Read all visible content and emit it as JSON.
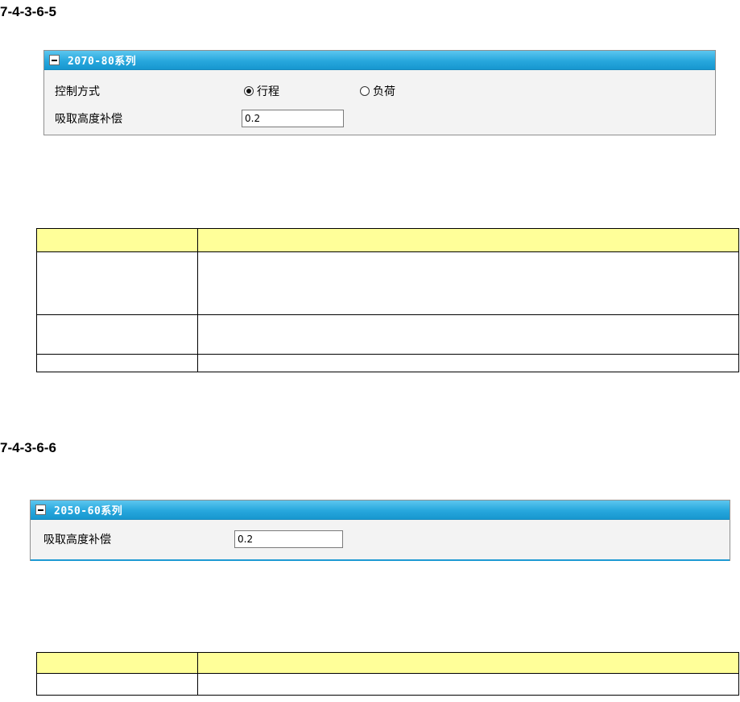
{
  "section1": {
    "number": "7-4-3-6-5",
    "panel": {
      "title": "2070-80系列",
      "control_label": "控制方式",
      "option_stroke": "行程",
      "option_load": "负荷",
      "selected": "行程",
      "comp_label": "吸取高度补偿",
      "comp_value": "0.2"
    }
  },
  "section2": {
    "number": "7-4-3-6-6",
    "panel": {
      "title": "2050-60系列",
      "comp_label": "吸取高度补偿",
      "comp_value": "0.2"
    }
  },
  "colors": {
    "header_blue": "#27a7dd",
    "table_header_yellow": "#ffff99"
  },
  "icons": {
    "collapse": "minus-icon",
    "radio_selected": "radio-selected-icon",
    "radio_unselected": "radio-unselected-icon"
  }
}
